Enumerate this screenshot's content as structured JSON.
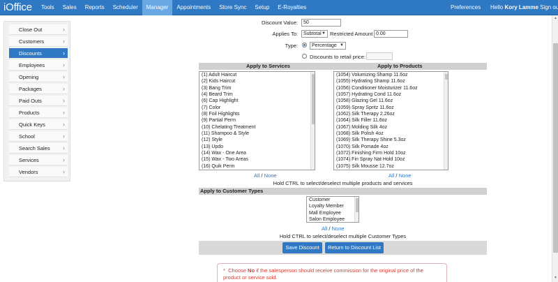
{
  "app": {
    "logo": "iOffice"
  },
  "nav": {
    "items": [
      "Tools",
      "Sales",
      "Reports",
      "Scheduler",
      "Manager",
      "Appointments",
      "Store Sync",
      "Setup",
      "E-Royalties"
    ],
    "active": "Manager",
    "preferences": "Preferences",
    "hello_prefix": "Hello",
    "user": "Kory Lamme",
    "signout": "Sign out"
  },
  "sidebar": {
    "items": [
      "Close Out",
      "Customers",
      "Discounts",
      "Employees",
      "Opening",
      "Packages",
      "Paid Outs",
      "Products",
      "Quick Keys",
      "School",
      "Search Sales",
      "Services",
      "Vendors"
    ],
    "active": "Discounts"
  },
  "form": {
    "discount_value_label": "Discount Value:",
    "discount_value": "50",
    "applies_to_label": "Applies To:",
    "applies_to_value": "Subtotal",
    "restricted_amount_label": "Restricted Amount",
    "restricted_amount": "0.00",
    "type_label": "Type:",
    "type_value": "Percentage",
    "type_option_retail": "Discounts to retail price:",
    "retail_price": ""
  },
  "services": {
    "header": "Apply to Services",
    "items": [
      "(1)  Adult Haircut",
      "(2)  Kids Haircut",
      "(3)  Bang Trim",
      "(4)  Beard Trim",
      "(6)  Cap Highlight",
      "(7)  Color",
      "(8)  Foil Highlights",
      "(9)  Partial Perm",
      "(10)  Chelating Treatment",
      "(11)  Shampoo & Style",
      "(12)  Style",
      "(13)  Updo",
      "(14)  Wax - One Area",
      "(15)  Wax - Two Areas",
      "(16)  Quik Perm"
    ]
  },
  "products": {
    "header": "Apply to Products",
    "items": [
      "(1054)  Volumizing Shamp 11.6oz",
      "(1055)  Hydrating Shamp 11.6oz",
      "(1056)  Conditioner Moisturizer 11.6oz",
      "(1057)  Hydrating Cond 11.6oz",
      "(1058)  Glazing Gel 11.6oz",
      "(1059)  Spray Spritz 11.6oz",
      "(1062)  Silk Therapy 2.26oz",
      "(1064)  Silk Filler 11.6oz",
      "(1067)  Molding Silk 4oz",
      "(1068)  Silk Polish 4oz",
      "(1069)  Silk Therapy Shine 5.3oz",
      "(1070)  Silk Pomade 4oz",
      "(1072)  Finishing Firm Hold 10oz",
      "(1074)  Fin Spray Nat Hold 10oz",
      "(1075)  Silk Mousse 12.7oz"
    ]
  },
  "selection": {
    "all": "All",
    "sep": " / ",
    "none": "None",
    "hint_products": "Hold CTRL to select/deselect multiple products and services",
    "hint_customers": "Hold CTRL to select/deselect multiple Customer Types"
  },
  "customer_types": {
    "header": "Apply to Customer Types",
    "items": [
      "Customer",
      "Loyalty Member",
      "Mall Employee",
      "Salon Employee"
    ]
  },
  "buttons": {
    "save": "Save Discount",
    "return": "Return to Discount List"
  },
  "notice": {
    "star": "*",
    "prefix": "Choose",
    "bold": "No",
    "text": "if the salesperson should receive commission for the original price of the product or service sold."
  }
}
